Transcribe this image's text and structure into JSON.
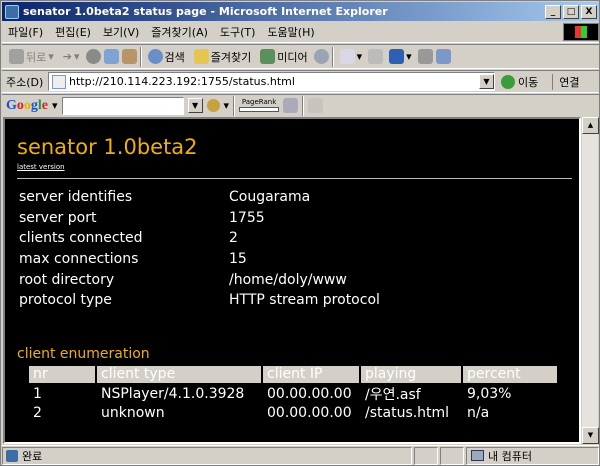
{
  "window": {
    "title": "senator 1.0beta2 status page - Microsoft Internet Explorer",
    "buttons": [
      "_",
      "□",
      "X"
    ]
  },
  "menu": [
    "파일(F)",
    "편집(E)",
    "보기(V)",
    "즐겨찾기(A)",
    "도구(T)",
    "도움말(H)"
  ],
  "toolbar": {
    "back": "뒤로",
    "search": "검색",
    "favorites": "즐겨찾기",
    "media": "미디어"
  },
  "address": {
    "label": "주소(D)",
    "url": "http://210.114.223.192:1755/status.html",
    "go": "이동",
    "links": "연결"
  },
  "googlebar": {
    "logo": [
      "G",
      "o",
      "o",
      "g",
      "l",
      "e"
    ],
    "pagerank": "PageRank"
  },
  "page": {
    "heading": "senator 1.0beta2",
    "latest_link": "latest version",
    "info": [
      {
        "key": "server identifies",
        "value": "Cougarama"
      },
      {
        "key": "server port",
        "value": "1755"
      },
      {
        "key": "clients connected",
        "value": "2"
      },
      {
        "key": "max connections",
        "value": "15"
      },
      {
        "key": "root directory",
        "value": "/home/doly/www"
      },
      {
        "key": "protocol type",
        "value": "HTTP stream protocol"
      }
    ],
    "section_title": "client enumeration",
    "table": {
      "headers": [
        "nr",
        "client type",
        "client IP",
        "playing",
        "percent"
      ],
      "rows": [
        [
          "1",
          "NSPlayer/4.1.0.3928",
          "00.00.00.00",
          "/우연.asf",
          "9,03%"
        ],
        [
          "2",
          "unknown",
          "00.00.00.00",
          "/status.html",
          "n/a"
        ]
      ]
    }
  },
  "status": {
    "text": "완료",
    "zone": "내 컴퓨터"
  },
  "colors": {
    "accent": "#f0b000",
    "titlebar_start": "#0a246a",
    "titlebar_end": "#a6caf0",
    "page_background": "#000000"
  }
}
